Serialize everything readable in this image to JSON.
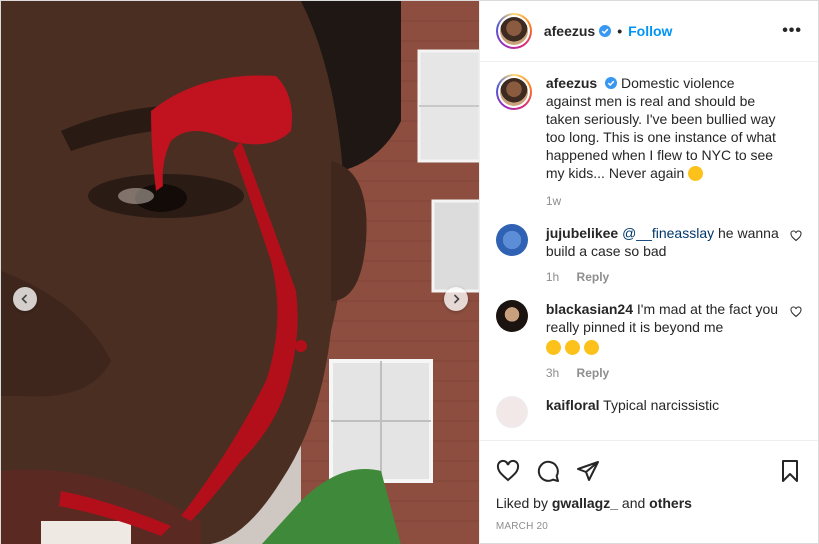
{
  "header": {
    "username": "afeezus",
    "verified_icon": "verified-badge-icon",
    "separator": "•",
    "follow_label": "Follow",
    "more_label": "•••"
  },
  "caption": {
    "username": "afeezus",
    "text": "Domestic violence against men is real and should be taken seriously. I've been bullied way too long. This is one instance of what happened when I flew to NYC to see my kids... Never again",
    "emoji": "upside-down-face",
    "time": "1w"
  },
  "comments": [
    {
      "username": "jujubelikee",
      "mention": "@__fineasslay",
      "text": "he wanna build a case so bad",
      "time": "1h",
      "reply_label": "Reply"
    },
    {
      "username": "blackasian24",
      "text": "I'm mad at the fact you really pinned it is beyond me",
      "emojis": "tears-of-joy x3",
      "time": "3h",
      "reply_label": "Reply"
    },
    {
      "username": "kaifloral",
      "text": "Typical narcissistic"
    }
  ],
  "actions": {
    "likes_prefix": "Liked by",
    "likes_user": "gwallagz_",
    "likes_and": "and",
    "likes_others": "others",
    "date": "MARCH 20"
  },
  "colors": {
    "link_blue": "#0095f6",
    "muted": "#8e8e8e",
    "text": "#262626",
    "border": "#efefef"
  }
}
